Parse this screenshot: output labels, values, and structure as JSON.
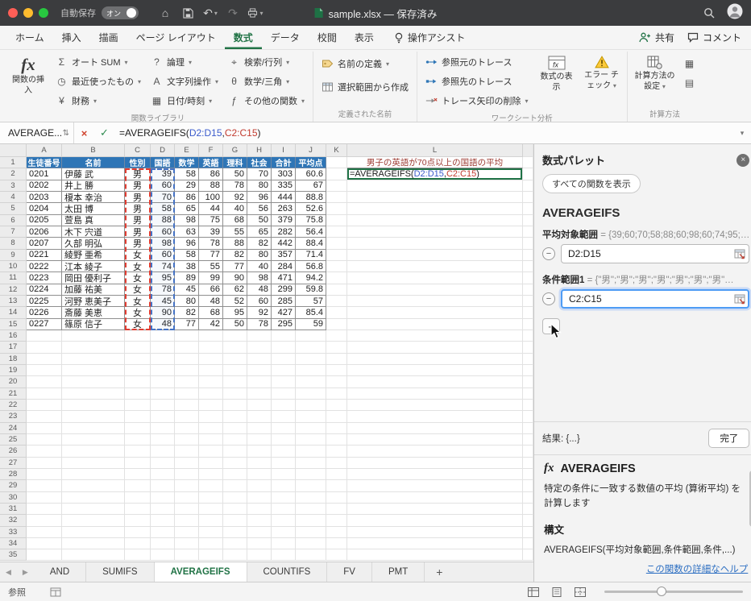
{
  "titlebar": {
    "autosave_label": "自動保存",
    "autosave_state": "オン",
    "title": "sample.xlsx — 保存済み"
  },
  "tabs": {
    "items": [
      "ホーム",
      "挿入",
      "描画",
      "ページ レイアウト",
      "数式",
      "データ",
      "校閲",
      "表示"
    ],
    "active_index": 4,
    "assist": "操作アシスト",
    "share": "共有",
    "comments": "コメント"
  },
  "ribbon": {
    "insert_function": "関数の挿入",
    "library_columns": [
      [
        {
          "label": "オート SUM",
          "icon": "autosum"
        },
        {
          "label": "最近使ったもの",
          "icon": "recent"
        },
        {
          "label": "財務",
          "icon": "finance"
        }
      ],
      [
        {
          "label": "論理",
          "icon": "logical"
        },
        {
          "label": "文字列操作",
          "icon": "text_fn"
        },
        {
          "label": "日付/時刻",
          "icon": "datetime"
        }
      ],
      [
        {
          "label": "検索/行列",
          "icon": "lookup"
        },
        {
          "label": "数学/三角",
          "icon": "math"
        },
        {
          "label": "その他の関数",
          "icon": "more_fn"
        }
      ]
    ],
    "group_library": "関数ライブラリ",
    "define_name": "名前の定義",
    "create_from_selection": "選択範囲から作成",
    "group_defined_names": "定義された名前",
    "trace_precedents": "参照元のトレース",
    "trace_dependents": "参照先のトレース",
    "remove_arrows": "トレース矢印の削除",
    "show_formulas": "数式の表示",
    "error_checking": "エラー チェック",
    "group_auditing": "ワークシート分析",
    "calculation_options": "計算方法の設定",
    "group_calculation": "計算方法"
  },
  "formula_bar": {
    "name_box": "AVERAGE...",
    "formula": {
      "prefix": "=AVERAGEIFS(",
      "arg1": "D2:D15",
      "sep": ",",
      "arg2": "C2:C15",
      "close": ")"
    }
  },
  "grid": {
    "columns": [
      "A",
      "B",
      "C",
      "D",
      "E",
      "F",
      "G",
      "H",
      "I",
      "J",
      "K",
      "L"
    ],
    "rows_visible": 35,
    "table_header": [
      "生徒番号",
      "名前",
      "性別",
      "国語",
      "数学",
      "英語",
      "理科",
      "社会",
      "合計",
      "平均点"
    ],
    "l1_title": "男子の英語が70点以上の国語の平均",
    "students": [
      {
        "id": "0201",
        "name": "伊藤 武",
        "gender": "男",
        "kokugo": 39,
        "sugaku": 58,
        "eigo": 86,
        "rika": 50,
        "shakai": 70,
        "total": 303,
        "avg": "60.6"
      },
      {
        "id": "0202",
        "name": "井上 勝",
        "gender": "男",
        "kokugo": 60,
        "sugaku": 29,
        "eigo": 88,
        "rika": 78,
        "shakai": 80,
        "total": 335,
        "avg": "67"
      },
      {
        "id": "0203",
        "name": "榎本 幸治",
        "gender": "男",
        "kokugo": 70,
        "sugaku": 86,
        "eigo": 100,
        "rika": 92,
        "shakai": 96,
        "total": 444,
        "avg": "88.8"
      },
      {
        "id": "0204",
        "name": "太田 博",
        "gender": "男",
        "kokugo": 58,
        "sugaku": 65,
        "eigo": 44,
        "rika": 40,
        "shakai": 56,
        "total": 263,
        "avg": "52.6"
      },
      {
        "id": "0205",
        "name": "萱島 真",
        "gender": "男",
        "kokugo": 88,
        "sugaku": 98,
        "eigo": 75,
        "rika": 68,
        "shakai": 50,
        "total": 379,
        "avg": "75.8"
      },
      {
        "id": "0206",
        "name": "木下 宍道",
        "gender": "男",
        "kokugo": 60,
        "sugaku": 63,
        "eigo": 39,
        "rika": 55,
        "shakai": 65,
        "total": 282,
        "avg": "56.4"
      },
      {
        "id": "0207",
        "name": "久部 明弘",
        "gender": "男",
        "kokugo": 98,
        "sugaku": 96,
        "eigo": 78,
        "rika": 88,
        "shakai": 82,
        "total": 442,
        "avg": "88.4"
      },
      {
        "id": "0221",
        "name": "綾野 亜希",
        "gender": "女",
        "kokugo": 60,
        "sugaku": 58,
        "eigo": 77,
        "rika": 82,
        "shakai": 80,
        "total": 357,
        "avg": "71.4"
      },
      {
        "id": "0222",
        "name": "江本 綾子",
        "gender": "女",
        "kokugo": 74,
        "sugaku": 38,
        "eigo": 55,
        "rika": 77,
        "shakai": 40,
        "total": 284,
        "avg": "56.8"
      },
      {
        "id": "0223",
        "name": "岡田 優利子",
        "gender": "女",
        "kokugo": 95,
        "sugaku": 89,
        "eigo": 99,
        "rika": 90,
        "shakai": 98,
        "total": 471,
        "avg": "94.2"
      },
      {
        "id": "0224",
        "name": "加藤 祐美",
        "gender": "女",
        "kokugo": 78,
        "sugaku": 45,
        "eigo": 66,
        "rika": 62,
        "shakai": 48,
        "total": 299,
        "avg": "59.8"
      },
      {
        "id": "0225",
        "name": "河野 恵美子",
        "gender": "女",
        "kokugo": 45,
        "sugaku": 80,
        "eigo": 48,
        "rika": 52,
        "shakai": 60,
        "total": 285,
        "avg": "57"
      },
      {
        "id": "0226",
        "name": "斎藤 美恵",
        "gender": "女",
        "kokugo": 90,
        "sugaku": 82,
        "eigo": 68,
        "rika": 95,
        "shakai": 92,
        "total": 427,
        "avg": "85.4"
      },
      {
        "id": "0227",
        "name": "篠原 信子",
        "gender": "女",
        "kokugo": 48,
        "sugaku": 77,
        "eigo": 42,
        "rika": 50,
        "shakai": 78,
        "total": 295,
        "avg": "59"
      }
    ]
  },
  "palette": {
    "title": "数式パレット",
    "show_all_functions": "すべての関数を表示",
    "function_name": "AVERAGEIFS",
    "args": [
      {
        "label": "平均対象範囲",
        "preview": "=  {39;60;70;58;88;60;98;60;74;95;…",
        "value": "D2:D15",
        "focused": false
      },
      {
        "label": "条件範囲1",
        "preview": "=  {\"男\";\"男\";\"男\";\"男\";\"男\";\"男\";\"男\"…",
        "value": "C2:C15",
        "focused": true
      }
    ],
    "result": "結果: {...}",
    "done": "完了",
    "doc_function": "AVERAGEIFS",
    "description": "特定の条件に一致する数値の平均 (算術平均) を計算します",
    "syntax_label": "構文",
    "syntax": "AVERAGEIFS(平均対象範囲,条件範囲,条件,...)",
    "help_link": "この関数の詳細なヘルプ"
  },
  "sheet_tabs": {
    "tabs": [
      "AND",
      "SUMIFS",
      "AVERAGEIFS",
      "COUNTIFS",
      "FV",
      "PMT"
    ],
    "active": "AVERAGEIFS"
  },
  "status_bar": {
    "mode": "参照"
  },
  "icons": {
    "autosum": "Σ",
    "recent": "◷",
    "finance": "¥",
    "logical": "?",
    "text_fn": "A",
    "datetime": "▦",
    "lookup": "⌖",
    "math": "θ",
    "more_fn": "ƒ",
    "home": "⌂",
    "undo": "↶",
    "redo": "↷",
    "chevron": "▾",
    "prev_sheet": "◀",
    "next_sheet": "▶",
    "add_sheet": "+",
    "stepper": "⇅",
    "cancel": "×",
    "enter": "✓",
    "minus": "−",
    "plus": "+",
    "close": "×",
    "fx": "fx",
    "calc_now": "▦",
    "calc_sheet": "▤"
  },
  "colors": {
    "table_header_bg": "#2E75B6",
    "range1_color": "#3B5BCC",
    "range2_color": "#C23B2F",
    "l1_text": "#9C3A32",
    "active_cell_border": "#1F7246",
    "tab_green": "#217346",
    "ants_red": "#E03C31",
    "ants_blue": "#4472C4"
  }
}
